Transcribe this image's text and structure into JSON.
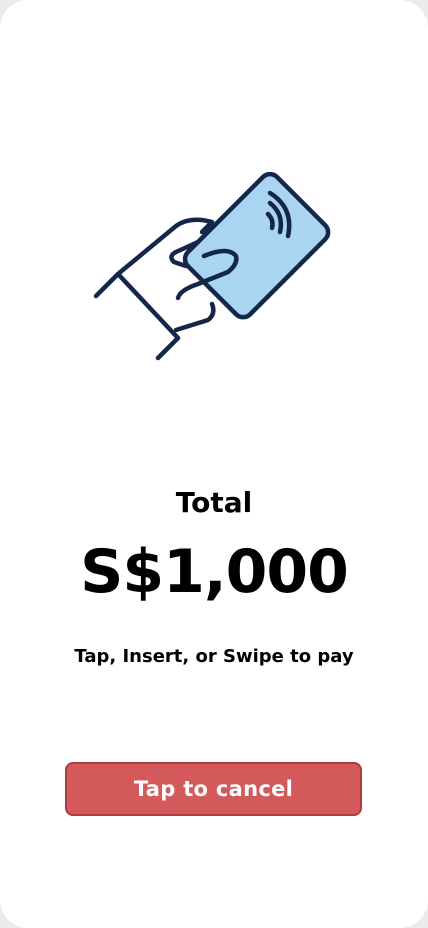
{
  "illustration": {
    "icon": "hand-tapping-card-icon",
    "card_color": "#a9d4f2",
    "outline_color": "#14264a"
  },
  "payment": {
    "total_label": "Total",
    "amount": "S$1,000",
    "instruction": "Tap, Insert, or Swipe to pay"
  },
  "actions": {
    "cancel_label": "Tap to cancel",
    "cancel_color": "#d3595b"
  }
}
